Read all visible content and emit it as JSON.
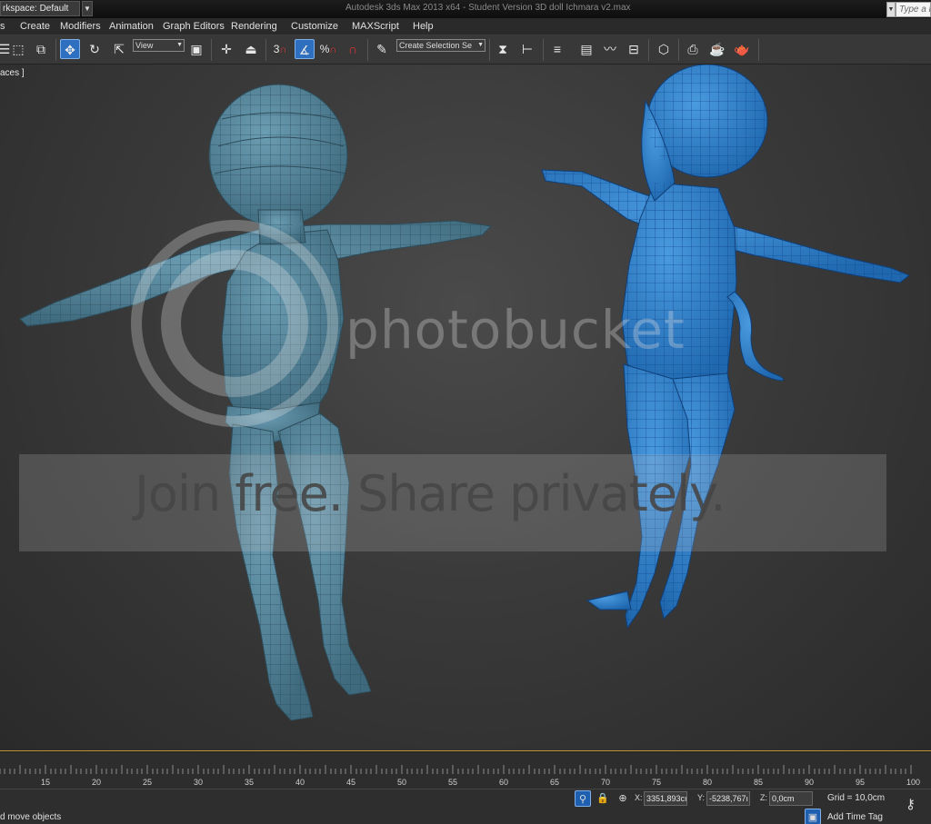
{
  "titlebar": {
    "workspace": "rkspace: Default",
    "title": "Autodesk 3ds Max  2013 x64  - Student Version    3D doll Ichmara v2.max",
    "search_placeholder": "Type a k"
  },
  "menu": {
    "items": [
      "s",
      "Create",
      "Modifiers",
      "Animation",
      "Graph Editors",
      "Rendering",
      "Customize",
      "MAXScript",
      "Help"
    ]
  },
  "toolbar": {
    "ref_coord": "View",
    "selection_set": "Create Selection Se",
    "snap_label": "3",
    "percent_label": "%"
  },
  "viewport": {
    "label": "aces ]",
    "watermark_logo": "photobucket",
    "watermark_slogan": "Join free. Share privately."
  },
  "timeline": {
    "ticks": [
      "15",
      "20",
      "25",
      "30",
      "35",
      "40",
      "45",
      "50",
      "55",
      "60",
      "65",
      "70",
      "75",
      "80",
      "85",
      "90",
      "95",
      "100"
    ]
  },
  "statusbar": {
    "prompt": "d move objects",
    "x_label": "X:",
    "x_value": "3351,893cı",
    "y_label": "Y:",
    "y_value": "-5238,767ı",
    "z_label": "Z:",
    "z_value": "0,0cm",
    "grid": "Grid = 10,0cm",
    "add_time_tag": "Add Time Tag"
  },
  "colors": {
    "accent": "#2e6fbf",
    "viewport_border": "#c09a3a",
    "left_model": "#4f8197",
    "right_model": "#2f7fc8"
  }
}
